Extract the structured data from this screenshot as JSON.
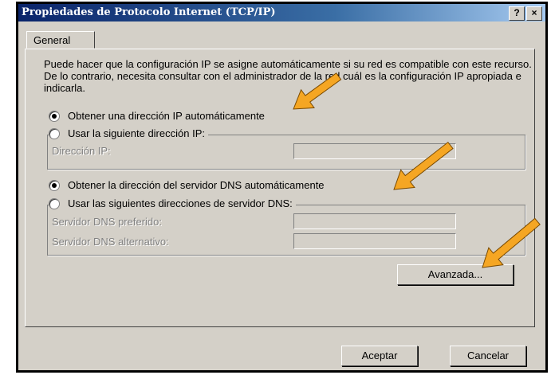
{
  "window": {
    "title": "Propiedades de Protocolo Internet (TCP/IP)",
    "help_button": "?",
    "close_button": "×"
  },
  "tabs": [
    {
      "label": "General",
      "selected": true
    }
  ],
  "description": "Puede hacer que la configuración IP se asigne automáticamente si su red es compatible con este recurso. De lo contrario, necesita consultar con el administrador de la red cuál es la configuración IP apropiada e indicarla.",
  "ip_options": {
    "auto": {
      "label": "Obtener una dirección IP automáticamente",
      "selected": true
    },
    "manual": {
      "label": "Usar la siguiente dirección IP:",
      "selected": false
    },
    "ip_address_label": "Dirección IP:"
  },
  "dns_options": {
    "auto": {
      "label": "Obtener la dirección del servidor DNS automáticamente",
      "selected": true
    },
    "manual": {
      "label": "Usar las siguientes direcciones de servidor DNS:",
      "selected": false
    },
    "preferred_label": "Servidor DNS preferido:",
    "alternate_label": "Servidor DNS alternativo:"
  },
  "buttons": {
    "advanced": "Avanzada...",
    "ok": "Aceptar",
    "cancel": "Cancelar"
  },
  "colors": {
    "arrow": "#f5a623",
    "titlebar": "#0a246a",
    "dialog_bg": "#d4d0c8"
  }
}
